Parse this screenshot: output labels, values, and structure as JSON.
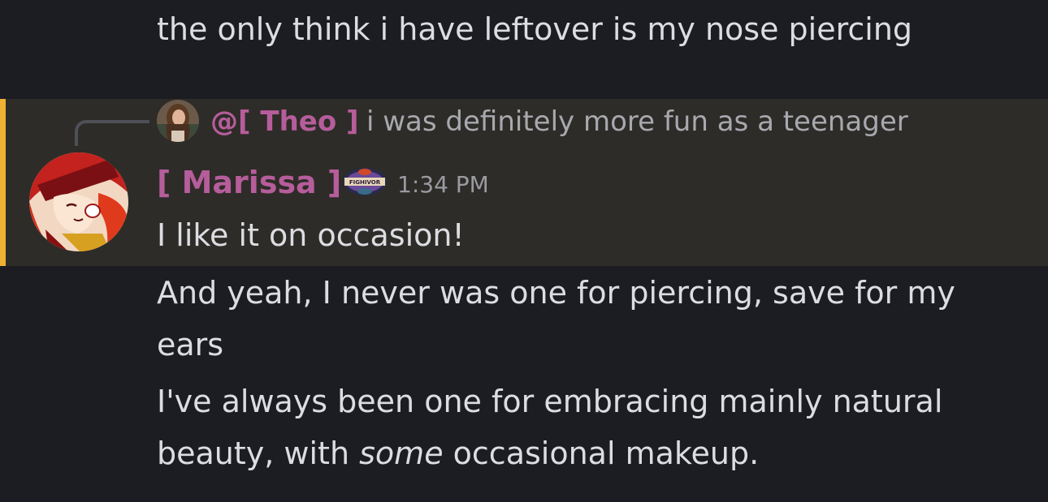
{
  "prev_message": {
    "text": "the only think i have leftover is my nose piercing"
  },
  "reply": {
    "author": "@[ Theo ]",
    "text": "i was definitely more fun as a teenager"
  },
  "message": {
    "username": "[ Marissa ]",
    "role_icon_text": "FIGHIVOR",
    "timestamp": "1:34 PM",
    "lines": [
      "I like it on occasion!",
      "And yeah, I never was one for piercing, save for my",
      "ears",
      "I've always been one for embracing mainly natural"
    ],
    "last_line_before": "beauty, with ",
    "last_line_emphasis": "some",
    "last_line_after": " occasional makeup."
  },
  "colors": {
    "background": "#1c1d22",
    "highlight_background": "#2e2c28",
    "highlight_bar": "#f0b232",
    "username": "#b65d9b",
    "text": "#dcdde1",
    "timestamp": "#9a9ba1"
  },
  "icons": {
    "reply_avatar": "user-avatar-photo",
    "author_avatar": "anime-avatar",
    "role_badge": "survivor-logo-icon"
  }
}
